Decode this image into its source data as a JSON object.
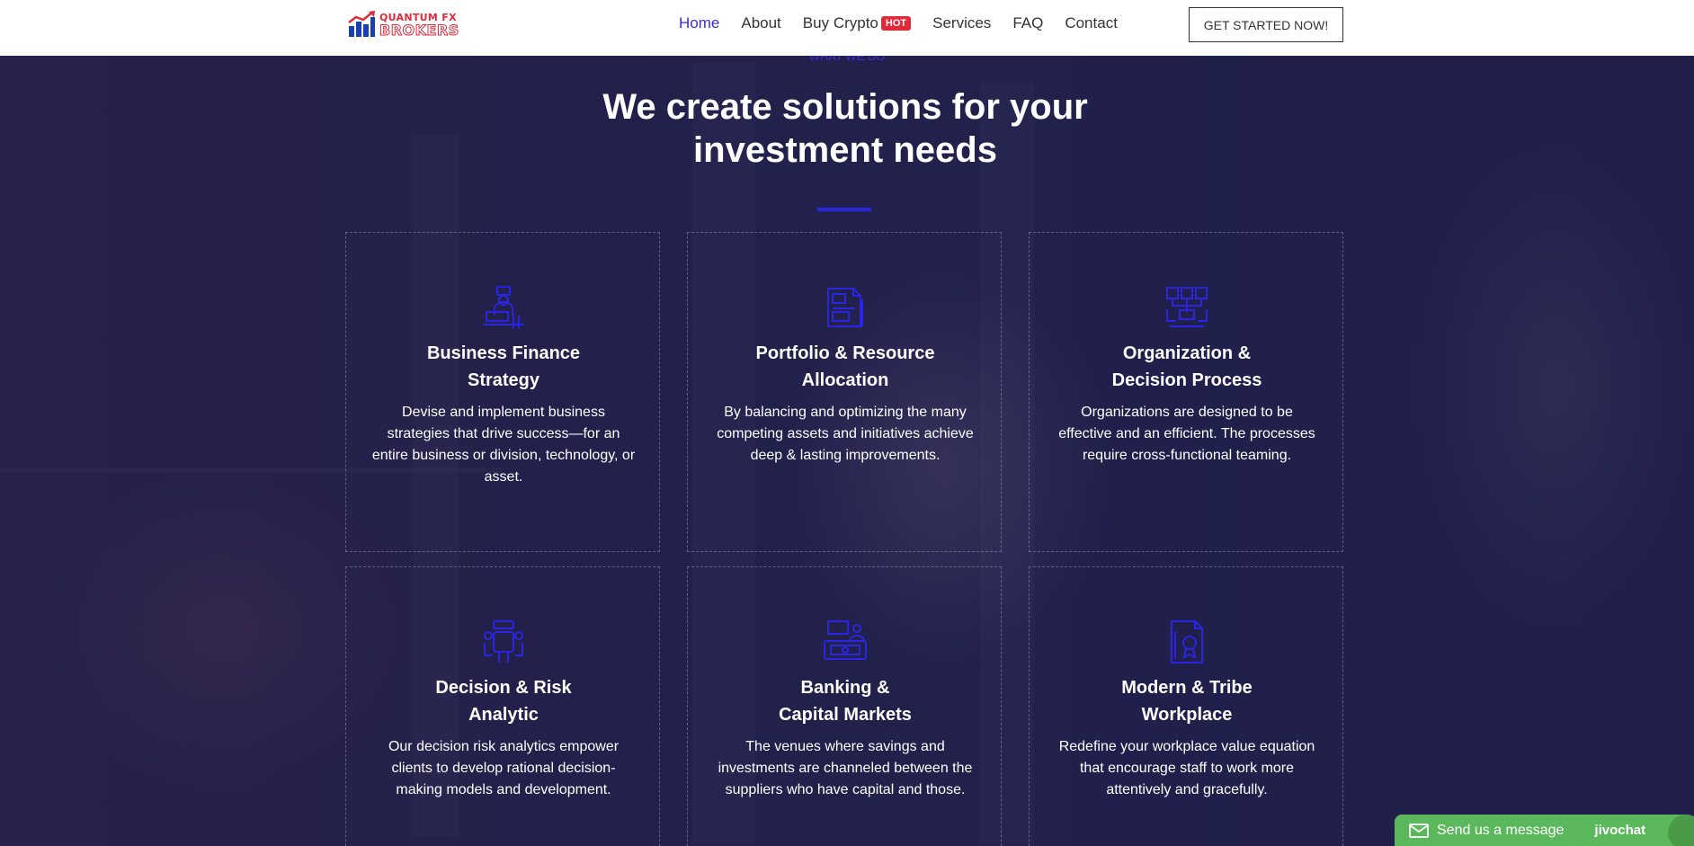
{
  "header": {
    "logo": {
      "line1": "QUANTUM FX",
      "line2": "BROKERS"
    },
    "nav": [
      {
        "label": "Home",
        "active": true
      },
      {
        "label": "About"
      },
      {
        "label": "Buy Crypto",
        "badge": "HOT"
      },
      {
        "label": "Services"
      },
      {
        "label": "FAQ"
      },
      {
        "label": "Contact"
      }
    ],
    "cta": "GET STARTED NOW!"
  },
  "section": {
    "eyebrow": "WHAT WE DO",
    "heading_line1": "We create solutions for your",
    "heading_line2": "investment needs"
  },
  "cards": [
    {
      "icon": "businessman-at-desk-icon",
      "title_line1": "Business Finance",
      "title_line2": "Strategy",
      "description": "Devise and implement business strategies that drive success—for an entire business or division, technology, or asset."
    },
    {
      "icon": "document-chart-icon",
      "title_line1": "Portfolio & Resource",
      "title_line2": "Allocation",
      "description": "By balancing and optimizing the many competing assets and initiatives achieve deep & lasting improvements."
    },
    {
      "icon": "org-chart-icon",
      "title_line1": "Organization &",
      "title_line2": "Decision Process",
      "description": "Organizations are designed to be effective and an efficient. The processes require cross-functional teaming."
    },
    {
      "icon": "meeting-table-icon",
      "title_line1": "Decision & Risk",
      "title_line2": "Analytic",
      "description": "Our decision risk analytics empower clients to develop rational decision-making models and development."
    },
    {
      "icon": "bank-money-icon",
      "title_line1": "Banking &",
      "title_line2": "Capital Markets",
      "description": "The venues where savings and investments are channeled between the suppliers who have capital and those."
    },
    {
      "icon": "certificate-document-icon",
      "title_line1": "Modern & Tribe",
      "title_line2": "Workplace",
      "description": "Redefine your workplace value equation that encourage staff to work more attentively and gracefully."
    }
  ],
  "chat": {
    "label": "Send us a message",
    "brand": "jivochat"
  },
  "colors": {
    "accent": "#3a2fd0",
    "icon": "#2a25e0",
    "hot": "#e02a3a",
    "chat": "#5cb85c"
  }
}
